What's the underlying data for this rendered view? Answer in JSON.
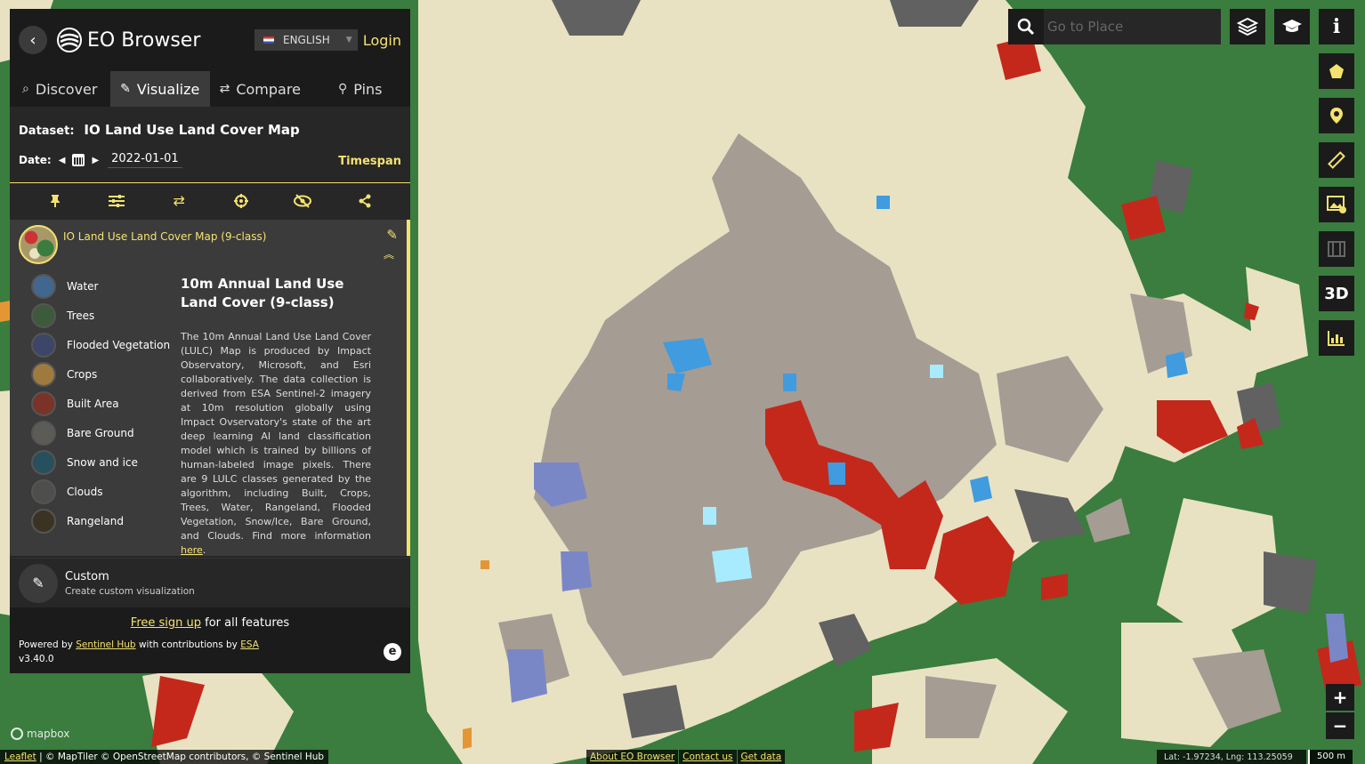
{
  "app": {
    "title": "EO Browser",
    "language": "ENGLISH",
    "login_label": "Login"
  },
  "tabs": [
    {
      "label": "Discover",
      "icon": "search-icon"
    },
    {
      "label": "Visualize",
      "icon": "brush-icon"
    },
    {
      "label": "Compare",
      "icon": "compare-icon"
    },
    {
      "label": "Pins",
      "icon": "pin-icon"
    }
  ],
  "dataset": {
    "label": "Dataset:",
    "name": "IO Land Use Land Cover Map"
  },
  "date": {
    "label": "Date:",
    "value": "2022-01-01",
    "timespan_label": "Timespan"
  },
  "toolbar_icons": [
    "pin-icon",
    "sliders-icon",
    "compare-icon",
    "crosshair-icon",
    "eye-slash-icon",
    "share-icon"
  ],
  "layer": {
    "title": "IO Land Use Land Cover Map (9-class)",
    "legend": [
      {
        "label": "Water",
        "color": "#41678f"
      },
      {
        "label": "Trees",
        "color": "#3d5a3b"
      },
      {
        "label": "Flooded Vegetation",
        "color": "#3d4568"
      },
      {
        "label": "Crops",
        "color": "#9f7a3e"
      },
      {
        "label": "Built Area",
        "color": "#7a3326"
      },
      {
        "label": "Bare Ground",
        "color": "#5d5b56"
      },
      {
        "label": "Snow and ice",
        "color": "#274f5d"
      },
      {
        "label": "Clouds",
        "color": "#4e4e4c"
      },
      {
        "label": "Rangeland",
        "color": "#3a3322"
      }
    ],
    "description_title": "10m Annual Land Use Land Cover (9-class)",
    "description_text": "The 10m Annual Land Use Land Cover (LULC) Map is produced by Impact Observatory, Microsoft, and Esri collaboratively. The data collection is derived from ESA Sentinel-2 imagery at 10m resolution globally using Impact Ovservatory's state of the art deep learning AI land classification model which is trained by billions of human-labeled image pixels. There are 9 LULC classes generated by the algorithm, including Built, Crops, Trees, Water, Rangeland, Flooded Vegetation, Snow/Ice, Bare Ground, and Clouds. Find more information",
    "description_link": "here",
    "description_end": "."
  },
  "custom": {
    "name": "Custom",
    "subtitle": "Create custom visualization"
  },
  "footer": {
    "signup_link": "Free sign up",
    "signup_rest": " for all features",
    "powered_prefix": "Powered by ",
    "powered_link": "Sentinel Hub",
    "powered_mid": " with contributions by ",
    "powered_esa": "ESA",
    "version": "v3.40.0"
  },
  "search": {
    "placeholder": "Go to Place"
  },
  "right_tools": [
    "polygon-icon",
    "location-pin-icon",
    "ruler-icon",
    "image-download-icon",
    "film-icon",
    "3D",
    "chart-icon"
  ],
  "zoom": {
    "in": "+",
    "out": "−"
  },
  "map_attribution": {
    "leaflet": "Leaflet",
    "rest": " | © MapTiler © OpenStreetMap contributors, © Sentinel Hub"
  },
  "bottom_links": [
    "About EO Browser",
    "Contact us",
    "Get data"
  ],
  "coords": "Lat: -1.97234, Lng: 113.25059",
  "scale": "500 m",
  "mapbox_label": "mapbox",
  "map_colors": {
    "trees": "#3a7d3e",
    "rangeland": "#e8e2c3",
    "bare": "#a59c94",
    "built": "#c4281b",
    "water": "#419bdf",
    "clouds": "#616161",
    "flooded": "#7a87c6",
    "snow": "#a8ebff",
    "crops": "#e49635"
  }
}
